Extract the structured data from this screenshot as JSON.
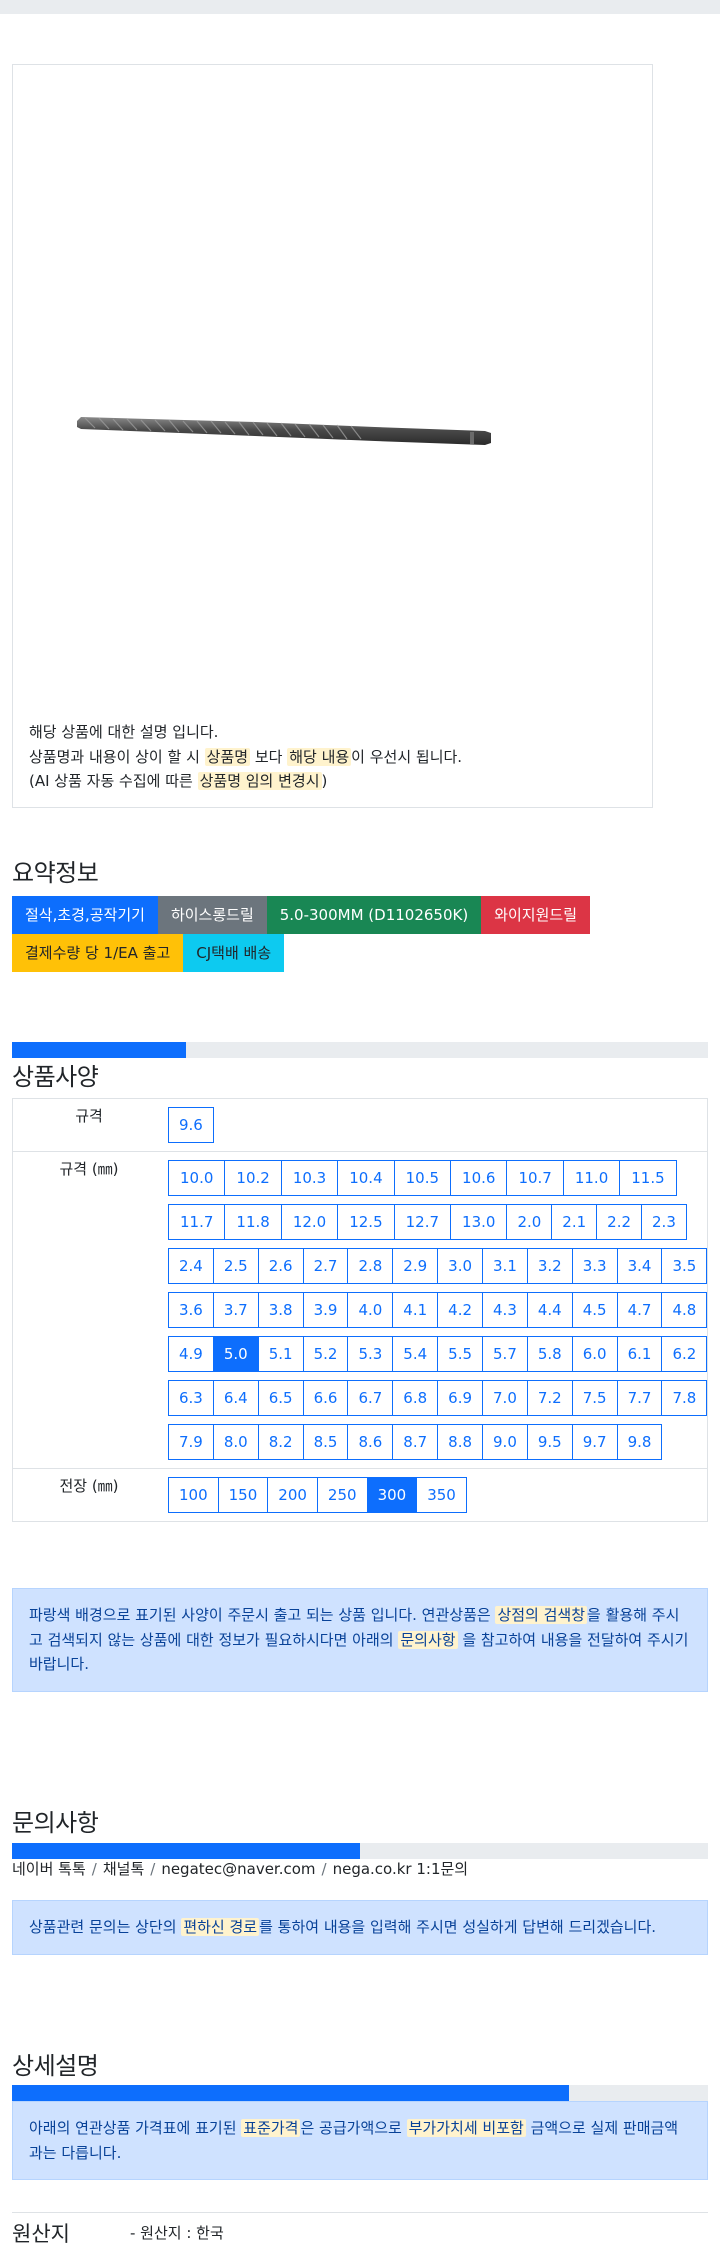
{
  "product": {
    "image_name": "drill-bit-image",
    "desc_line1": "해당 상품에 대한 설명 입니다.",
    "desc_line2_a": "상품명과 내용이 상이 할 시 ",
    "desc_line2_hl1": "상품명",
    "desc_line2_b": " 보다 ",
    "desc_line2_hl2": "해당 내용",
    "desc_line2_c": "이 우선시 됩니다.",
    "desc_line3_a": "(AI 상품 자동 수집에 따른 ",
    "desc_line3_hl": "상품명 임의 변경시",
    "desc_line3_b": ")"
  },
  "summary": {
    "title": "요약정보",
    "badges_row1": [
      {
        "label": "절삭,초경,공작기기",
        "color": "#0d6efd"
      },
      {
        "label": "하이스롱드릴",
        "color": "#6c757d"
      },
      {
        "label": "5.0-300MM (D1102650K)",
        "color": "#198754"
      },
      {
        "label": "와이지원드릴",
        "color": "#dc3545"
      }
    ],
    "badges_row2": [
      {
        "label": "결제수량 당 1/EA 출고",
        "color": "#ffc107"
      },
      {
        "label": "CJ택배 배송",
        "color": "#0dcaf0"
      }
    ]
  },
  "spec": {
    "progress_fraction": 0.25,
    "title": "상품사양",
    "rows": [
      {
        "label": "규격",
        "options": [
          "9.6"
        ],
        "selected": ""
      },
      {
        "label": "규격 (㎜)",
        "options": [
          "10.0",
          "10.2",
          "10.3",
          "10.4",
          "10.5",
          "10.6",
          "10.7",
          "11.0",
          "11.5",
          "11.7",
          "11.8",
          "12.0",
          "12.5",
          "12.7",
          "13.0",
          "2.0",
          "2.1",
          "2.2",
          "2.3",
          "2.4",
          "2.5",
          "2.6",
          "2.7",
          "2.8",
          "2.9",
          "3.0",
          "3.1",
          "3.2",
          "3.3",
          "3.4",
          "3.5",
          "3.6",
          "3.7",
          "3.8",
          "3.9",
          "4.0",
          "4.1",
          "4.2",
          "4.3",
          "4.4",
          "4.5",
          "4.7",
          "4.8",
          "4.9",
          "5.0",
          "5.1",
          "5.2",
          "5.3",
          "5.4",
          "5.5",
          "5.7",
          "5.8",
          "6.0",
          "6.1",
          "6.2",
          "6.3",
          "6.4",
          "6.5",
          "6.6",
          "6.7",
          "6.8",
          "6.9",
          "7.0",
          "7.2",
          "7.5",
          "7.7",
          "7.8",
          "7.9",
          "8.0",
          "8.2",
          "8.5",
          "8.6",
          "8.7",
          "8.8",
          "9.0",
          "9.5",
          "9.7",
          "9.8"
        ],
        "selected": "5.0"
      },
      {
        "label": "전장 (㎜)",
        "options": [
          "100",
          "150",
          "200",
          "250",
          "300",
          "350"
        ],
        "selected": "300"
      }
    ],
    "notice_a": "파랑색 배경으로 표기된 사양이 주문시 출고 되는 상품 입니다. 연관상품은 ",
    "notice_hl1": "상점의 검색창",
    "notice_b": "을 활용해 주시고 검색되지 않는 상품에 대한 정보가 필요하시다면 아래의 ",
    "notice_hl2": "문의사항",
    "notice_c": " 을 참고하여 내용을 전달하여 주시기 바랍니다."
  },
  "inquiry": {
    "title": "문의사항",
    "progress_fraction": 0.5,
    "links": [
      "네이버 톡톡",
      "채널톡",
      "negatec@naver.com",
      "nega.co.kr 1:1문의"
    ],
    "separator": "/",
    "notice_a": "상품관련 문의는 상단의 ",
    "notice_hl": "편하신 경로",
    "notice_b": "를 통하여 내용을 입력해 주시면 성실하게 답변해 드리겠습니다."
  },
  "detail": {
    "title": "상세설명",
    "progress_fraction": 0.8,
    "notice_a": "아래의 연관상품 가격표에 표기된 ",
    "notice_hl1": "표준가격",
    "notice_b": "은 공급가액으로 ",
    "notice_hl2": "부가가치세 비포함",
    "notice_c": " 금액으로 실제 판매금액과는 다릅니다."
  },
  "origin": {
    "label": "원산지",
    "value": "- 원산지 : 한국"
  }
}
